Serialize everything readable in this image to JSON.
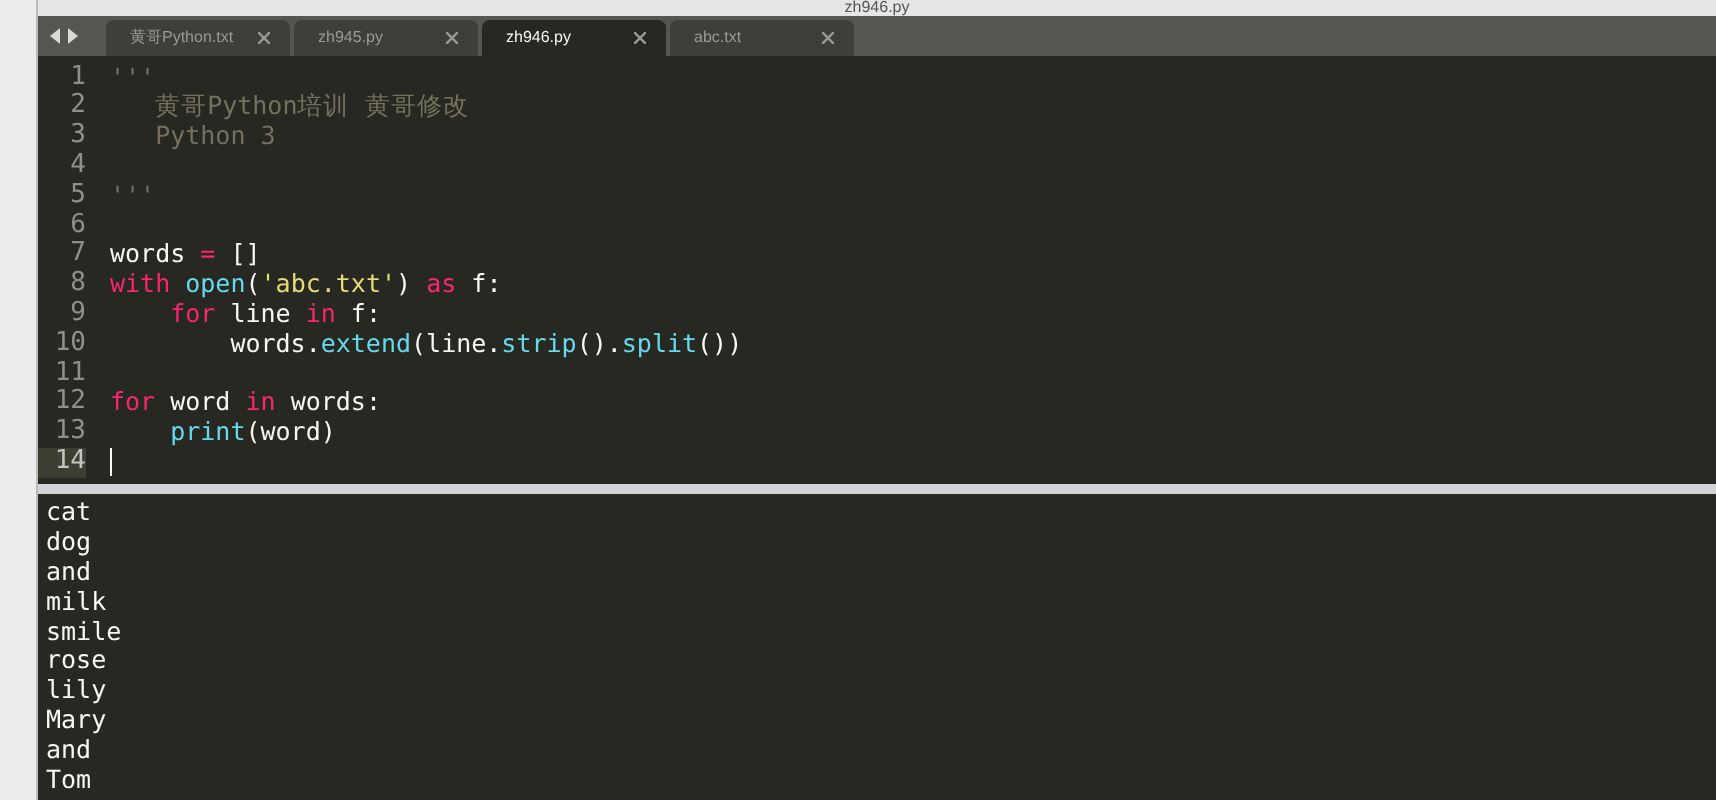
{
  "window": {
    "title": "zh946.py"
  },
  "tabs": [
    {
      "label": "黄哥Python.txt",
      "selected": false
    },
    {
      "label": "zh945.py",
      "selected": false
    },
    {
      "label": "zh946.py",
      "selected": true
    },
    {
      "label": "abc.txt",
      "selected": false
    }
  ],
  "editor": {
    "lines": [
      {
        "number": "1",
        "current": false,
        "tokens": [
          {
            "kind": "comment",
            "text": "'''"
          }
        ]
      },
      {
        "number": "2",
        "current": false,
        "tokens": [
          {
            "kind": "comment",
            "text": "   黄哥Python培训 黄哥修改"
          }
        ]
      },
      {
        "number": "3",
        "current": false,
        "tokens": [
          {
            "kind": "comment",
            "text": "   Python 3"
          }
        ]
      },
      {
        "number": "4",
        "current": false
      },
      {
        "number": "5",
        "current": false,
        "tokens": [
          {
            "kind": "comment",
            "text": "'''"
          }
        ]
      },
      {
        "number": "6",
        "current": false
      },
      {
        "number": "7",
        "current": false,
        "tokens": [
          {
            "kind": "plain",
            "text": "words "
          },
          {
            "kind": "keyword",
            "text": "="
          },
          {
            "kind": "plain",
            "text": " []"
          }
        ]
      },
      {
        "number": "8",
        "current": false,
        "tokens": [
          {
            "kind": "keyword",
            "text": "with"
          },
          {
            "kind": "func",
            "text": " open"
          },
          {
            "kind": "plain",
            "text": "("
          },
          {
            "kind": "string",
            "text": "'abc.txt'"
          },
          {
            "kind": "plain",
            "text": ") "
          },
          {
            "kind": "keyword",
            "text": "as"
          },
          {
            "kind": "plain",
            "text": " f:"
          }
        ]
      },
      {
        "number": "9",
        "current": false,
        "tokens": [
          {
            "kind": "keyword",
            "text": "    for"
          },
          {
            "kind": "plain",
            "text": " line "
          },
          {
            "kind": "keyword",
            "text": "in"
          },
          {
            "kind": "plain",
            "text": " f:"
          }
        ]
      },
      {
        "number": "10",
        "current": false,
        "tokens": [
          {
            "kind": "plain",
            "text": "        words."
          },
          {
            "kind": "func",
            "text": "extend"
          },
          {
            "kind": "plain",
            "text": "(line."
          },
          {
            "kind": "func",
            "text": "strip"
          },
          {
            "kind": "plain",
            "text": "()."
          },
          {
            "kind": "func",
            "text": "split"
          },
          {
            "kind": "plain",
            "text": "())"
          }
        ]
      },
      {
        "number": "11",
        "current": false
      },
      {
        "number": "12",
        "current": false,
        "tokens": [
          {
            "kind": "keyword",
            "text": "for"
          },
          {
            "kind": "plain",
            "text": " word "
          },
          {
            "kind": "keyword",
            "text": "in"
          },
          {
            "kind": "plain",
            "text": " words:"
          }
        ]
      },
      {
        "number": "13",
        "current": false,
        "tokens": [
          {
            "kind": "func",
            "text": "    print"
          },
          {
            "kind": "plain",
            "text": "(word)"
          }
        ]
      },
      {
        "number": "14",
        "current": true
      }
    ]
  },
  "output": {
    "lines": [
      "cat",
      "dog",
      "and",
      "milk",
      "smile",
      "rose",
      "lily",
      "Mary",
      "and",
      "Tom"
    ]
  }
}
